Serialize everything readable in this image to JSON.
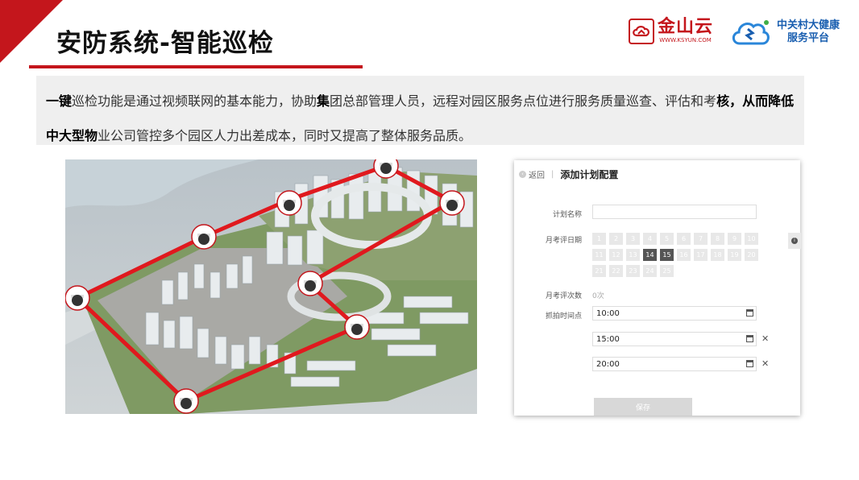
{
  "header": {
    "title": "安防系统-智能巡检",
    "logo_kingsoft": {
      "name": "金山云",
      "sub": "WWW.KSYUN.COM"
    },
    "logo_zgc": {
      "line1": "中关村大健康",
      "line2": "服务平台"
    }
  },
  "description": {
    "lead": "一键",
    "part1": "巡检功能是通过视频联网的基本能力，协助",
    "bold1": "集",
    "part2": "团总部管理人员，远程对园区服务点位进行服务质量巡查、评估和考",
    "bold2": "核，从而降低中大型物",
    "part3": "业公司管控多个园区人力出差成本，同时又提高了整体服务品质。"
  },
  "form": {
    "back_label": "返回",
    "title": "添加计划配置",
    "plan_name_label": "计划名称",
    "plan_name_value": "",
    "date_label": "月考评日期",
    "days": [
      "1",
      "2",
      "3",
      "4",
      "5",
      "6",
      "7",
      "8",
      "9",
      "10",
      "11",
      "12",
      "13",
      "14",
      "15",
      "16",
      "17",
      "18",
      "19",
      "20",
      "21",
      "22",
      "23",
      "24",
      "25"
    ],
    "selected_days": [
      "14",
      "15"
    ],
    "count_label": "月考评次数",
    "count_value": "0次",
    "time_label": "抓拍时间点",
    "times": [
      "10:00",
      "15:00",
      "20:00"
    ],
    "remove_symbol": "✕",
    "save_label": "保存"
  },
  "icons": {
    "back": "back-icon",
    "calendar": "calendar-icon",
    "info": "info-icon",
    "camera": "dome-camera-icon"
  },
  "colors": {
    "brand_red": "#c4161c",
    "route_red": "#e0191e",
    "zgc_blue": "#1a5fb0"
  }
}
